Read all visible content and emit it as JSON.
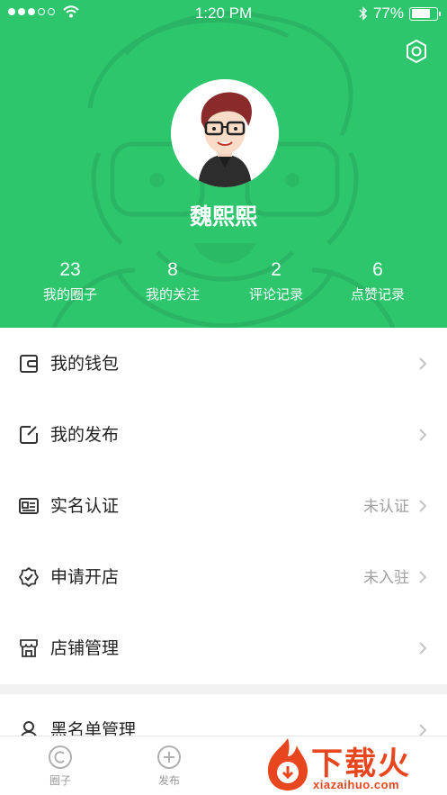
{
  "status_bar": {
    "time": "1:20 PM",
    "battery_percent": "77%",
    "battery_level": 0.77
  },
  "profile": {
    "username": "魏熙熙",
    "stats": [
      {
        "value": "23",
        "label": "我的圈子"
      },
      {
        "value": "8",
        "label": "我的关注"
      },
      {
        "value": "2",
        "label": "评论记录"
      },
      {
        "value": "6",
        "label": "点赞记录"
      }
    ]
  },
  "menu": [
    {
      "label": "我的钱包",
      "value": "",
      "icon": "wallet-icon"
    },
    {
      "label": "我的发布",
      "value": "",
      "icon": "edit-icon"
    },
    {
      "label": "实名认证",
      "value": "未认证",
      "icon": "id-card-icon"
    },
    {
      "label": "申请开店",
      "value": "未入驻",
      "icon": "badge-check-icon"
    },
    {
      "label": "店铺管理",
      "value": "",
      "icon": "store-icon"
    }
  ],
  "menu_2": [
    {
      "label": "黑名单管理",
      "value": "",
      "icon": "user-icon"
    }
  ],
  "tabbar": [
    {
      "label": "圈子",
      "icon": "circle-c-icon"
    },
    {
      "label": "发布",
      "icon": "plus-circle-icon"
    }
  ],
  "watermark": {
    "text_cn": "下载火",
    "text_en": "xiazaihuo.com"
  },
  "colors": {
    "header_green": "#2ec66d",
    "watermark_orange": "#e8461e"
  }
}
